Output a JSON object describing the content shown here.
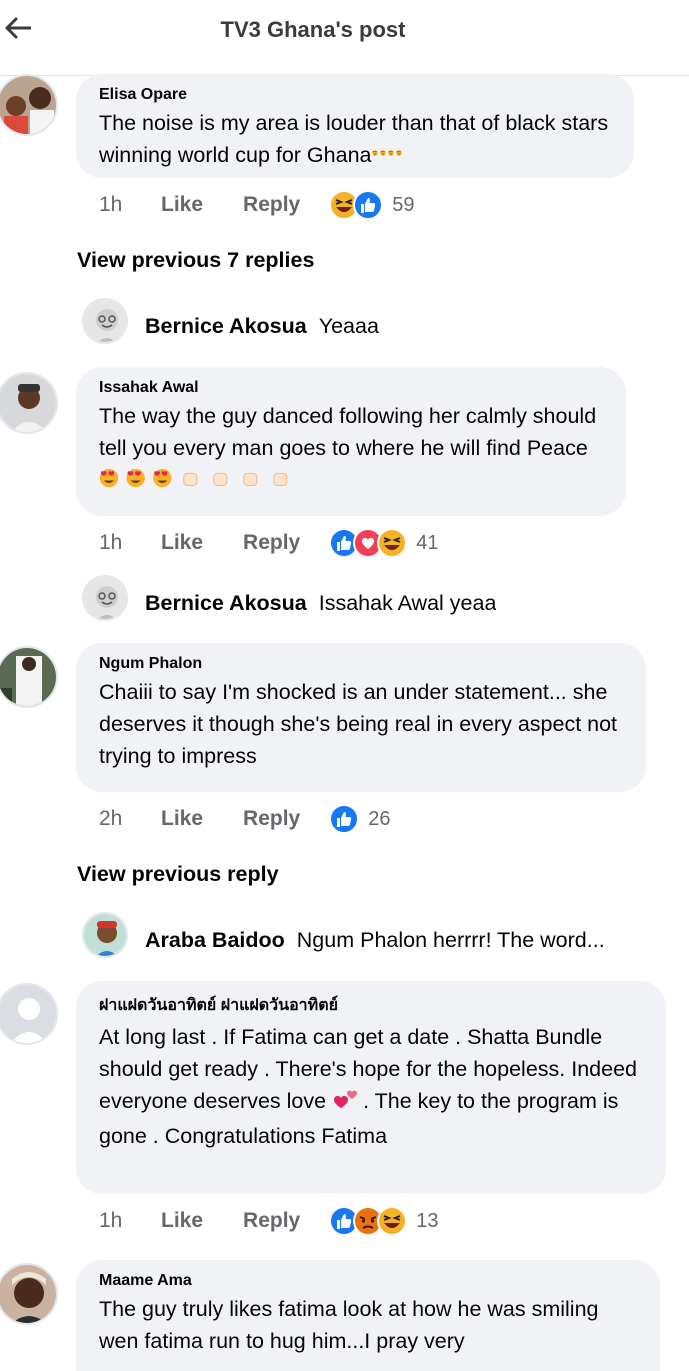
{
  "header": {
    "title": "TV3 Ghana's post"
  },
  "comments": [
    {
      "name": "Elisa Opare",
      "text": "The noise is my area is louder than that of black stars winning world cup for Ghana",
      "time": "1h",
      "like": "Like",
      "reply": "Reply",
      "reaction_count": "59"
    },
    {
      "name": "Issahak Awal",
      "text": "The way the guy danced following her calmly should tell you every man goes to where he will find Peace",
      "time": "1h",
      "like": "Like",
      "reply": "Reply",
      "reaction_count": "41"
    },
    {
      "name": "Ngum Phalon",
      "text": "Chaiii to say I'm shocked is an under statement... she deserves it though she's being real in every aspect not trying to impress",
      "time": "2h",
      "like": "Like",
      "reply": "Reply",
      "reaction_count": "26"
    },
    {
      "name": "ฝาแฝดวันอาทิตย์ ฝาแฝดวันอาทิตย์",
      "text_a": "At long last . If Fatima can get a date . Shatta Bundle should get ready . There's hope for the hopeless. Indeed everyone deserves love",
      "text_b": ".   The key to the program is gone . Congratulations Fatima",
      "time": "1h",
      "like": "Like",
      "reply": "Reply",
      "reaction_count": "13"
    },
    {
      "name": "Maame Ama",
      "text": "The guy truly  likes fatima  look at how he was smiling  wen fatima  run to hug him...I pray  very"
    }
  ],
  "view_prev_7": "View previous 7 replies",
  "view_prev_1": "View previous reply",
  "replies": [
    {
      "name": "Bernice Akosua",
      "text": "Yeaaa"
    },
    {
      "name": "Bernice Akosua",
      "text": "Issahak Awal yeaa"
    },
    {
      "name": "Araba Baidoo",
      "text": "Ngum Phalon herrrr! The word..."
    }
  ],
  "colors": {
    "bubble": "#f0f2f5",
    "like_blue": "#1877f2",
    "love_red": "#f33e58",
    "emoji_yellow": "#f7b125"
  }
}
